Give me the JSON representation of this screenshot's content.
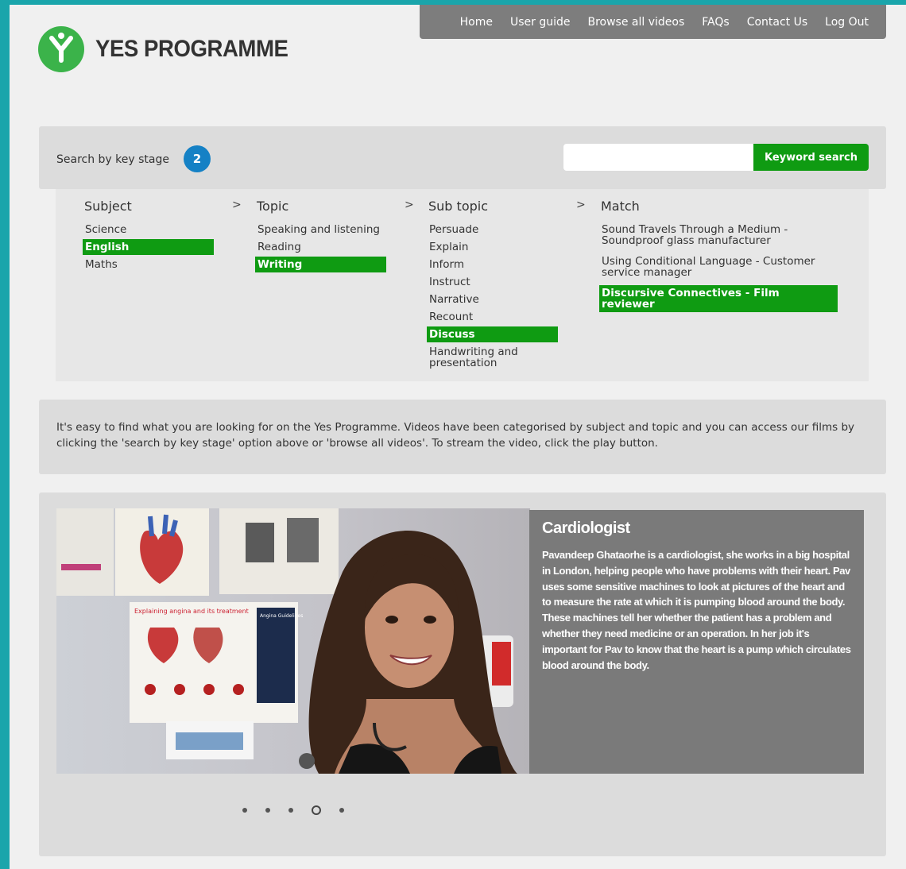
{
  "nav": {
    "items": [
      "Home",
      "User guide",
      "Browse all videos",
      "FAQs",
      "Contact Us",
      "Log Out"
    ]
  },
  "logo": {
    "text": "YES PROGRAMME",
    "color": "#3bb34a"
  },
  "search": {
    "label": "Search by key stage",
    "key_stage": "2",
    "keyword_value": "",
    "keyword_placeholder": "",
    "keyword_button": "Keyword search"
  },
  "filters": {
    "subject": {
      "heading": "Subject",
      "options": [
        "Science",
        "English",
        "Maths"
      ],
      "selected": "English"
    },
    "topic": {
      "heading": "Topic",
      "options": [
        "Speaking and listening",
        "Reading",
        "Writing"
      ],
      "selected": "Writing"
    },
    "subtopic": {
      "heading": "Sub topic",
      "options": [
        "Persuade",
        "Explain",
        "Inform",
        "Instruct",
        "Narrative",
        "Recount",
        "Discuss",
        "Handwriting and presentation"
      ],
      "selected": "Discuss"
    },
    "match": {
      "heading": "Match",
      "options": [
        "Sound Travels Through a Medium - Soundproof glass manufacturer",
        "Using Conditional Language - Customer service manager",
        "Discursive Connectives - Film reviewer"
      ],
      "selected": "Discursive Connectives - Film reviewer"
    },
    "separator": ">"
  },
  "info": {
    "text": "It's easy to find what you are looking for on the Yes Programme. Videos have been categorised by subject and topic and you can access our films by clicking the 'search by key stage' option above or 'browse all videos'. To stream the video, click the play button."
  },
  "feature": {
    "title": "Cardiologist",
    "description": "Pavandeep Ghataorhe is a cardiologist, she works in a big hospital in London, helping people who have problems with their heart. Pav uses some sensitive machines to look at pictures of the heart and to measure the rate at which it is pumping blood around the body. These machines tell her whether the patient has a problem and whether they need medicine or an operation. In her job it's important for Pav to know that the heart is a pump which circulates blood around the body.",
    "poster_labels": {
      "poster_title": "Explaining angina and its treatment",
      "guidelines": "Angina Guidelines"
    },
    "slides": 5,
    "active_slide": 4
  },
  "colors": {
    "accent": "#0f9b12",
    "badge": "#1581c5",
    "nav_bg": "#7d7d7d",
    "frame": "#1aa5ab"
  }
}
